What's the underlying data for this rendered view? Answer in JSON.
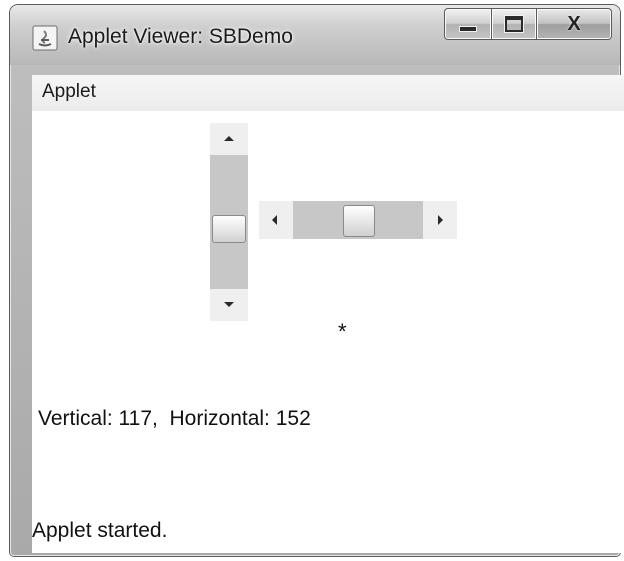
{
  "window": {
    "title": "Applet Viewer: SBDemo",
    "icon": "java-applet-icon",
    "buttons": {
      "minimize": "minimize-icon",
      "maximize": "maximize-icon",
      "close": "X"
    }
  },
  "menubar": {
    "items": [
      "Applet"
    ]
  },
  "applet": {
    "vertical_scrollbar": {
      "value": 117,
      "up_icon": "arrow-up-icon",
      "down_icon": "arrow-down-icon"
    },
    "horizontal_scrollbar": {
      "value": 152,
      "left_icon": "arrow-left-icon",
      "right_icon": "arrow-right-icon"
    },
    "cursor_mark": "*",
    "readout": "Vertical: 117,  Horizontal: 152"
  },
  "status_bar": {
    "text": "Applet started."
  },
  "colors": {
    "track": "#c7c7c7",
    "background": "#ffffff",
    "titlebar": "#cfcfcf"
  }
}
